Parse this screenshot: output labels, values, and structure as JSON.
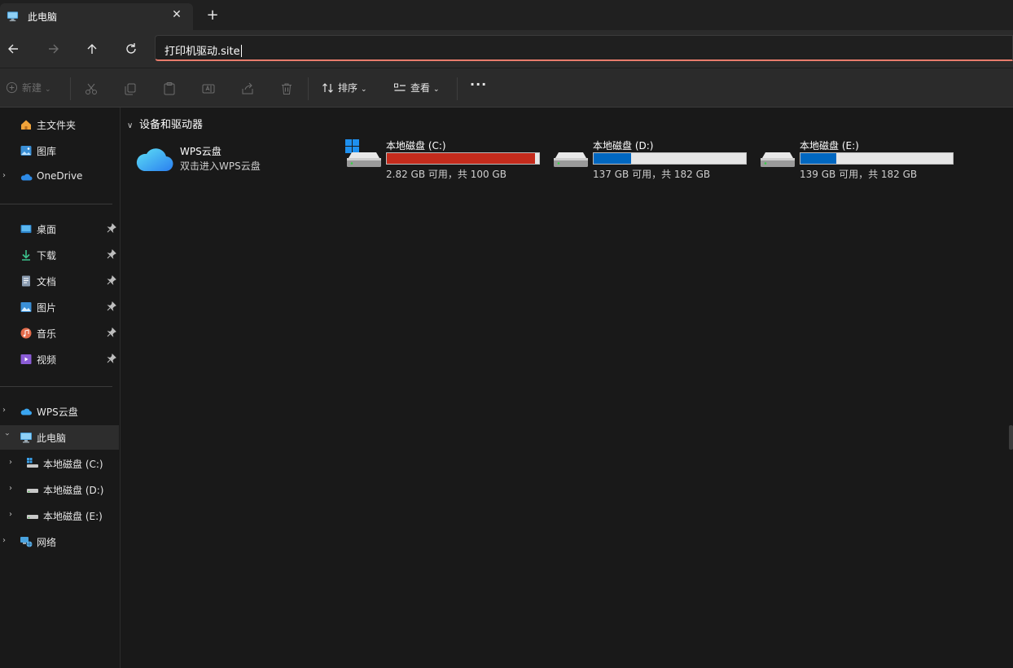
{
  "tab": {
    "title": "此电脑",
    "close_glyph": "✕",
    "new_tab_glyph": "+"
  },
  "nav": {
    "back_icon": "back-arrow-icon",
    "forward_icon": "forward-arrow-icon",
    "up_icon": "up-arrow-icon",
    "refresh_icon": "refresh-icon",
    "address_value": "打印机驱动.site"
  },
  "command_bar": {
    "new_label": "新建",
    "sort_label": "排序",
    "view_label": "查看",
    "more_glyph": "···"
  },
  "sidebar": {
    "home": "主文件夹",
    "gallery": "图库",
    "onedrive": "OneDrive",
    "desktop": "桌面",
    "downloads": "下载",
    "documents": "文档",
    "pictures": "图片",
    "music": "音乐",
    "videos": "视频",
    "wps_cloud": "WPS云盘",
    "this_pc": "此电脑",
    "drive_c": "本地磁盘 (C:)",
    "drive_d": "本地磁盘 (D:)",
    "drive_e": "本地磁盘 (E:)",
    "network": "网络"
  },
  "main": {
    "group_title": "设备和驱动器",
    "cloud": {
      "name": "WPS云盘",
      "subtitle": "双击进入WPS云盘"
    },
    "drives": [
      {
        "name": "本地磁盘 (C:)",
        "free_text": "2.82 GB 可用，共 100 GB",
        "used_fraction": 0.972,
        "bar_color": "#c42b1c"
      },
      {
        "name": "本地磁盘 (D:)",
        "free_text": "137 GB 可用，共 182 GB",
        "used_fraction": 0.247,
        "bar_color": "#0067c0"
      },
      {
        "name": "本地磁盘 (E:)",
        "free_text": "139 GB 可用，共 182 GB",
        "used_fraction": 0.236,
        "bar_color": "#0067c0"
      }
    ]
  },
  "colors": {
    "accent_address_underline": "#e87c6c",
    "selection": "#2d2d2d"
  }
}
